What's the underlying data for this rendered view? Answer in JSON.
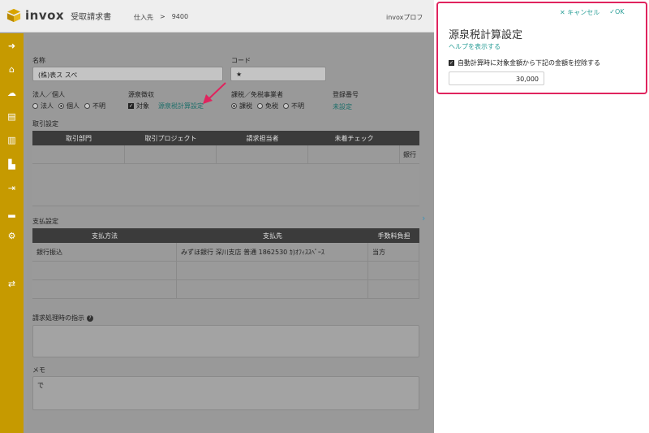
{
  "header": {
    "logo_text": "invox",
    "logo_sub": "受取請求書",
    "breadcrumb_section": "仕入先",
    "breadcrumb_sep": ">",
    "breadcrumb_code": "9400",
    "right_text": "invoxプロフ"
  },
  "sidebar": {
    "icons": [
      "arrow-circle-icon",
      "home-icon",
      "upload-icon",
      "document-icon",
      "document-list-icon",
      "building-icon",
      "export-icon",
      "chart-icon",
      "gear-icon",
      "transfer-icon"
    ]
  },
  "form": {
    "name_label": "名称",
    "name_value": "(株)表ス スペ",
    "code_label": "コード",
    "code_value": "★",
    "entity_label": "法人／個人",
    "entity_options": [
      "法人",
      "個人",
      "不明"
    ],
    "entity_selected": "個人",
    "withholding_label": "源泉徴収",
    "withholding_check_label": "対象",
    "withholding_link": "源泉税計算設定",
    "tax_label": "課税／免税事業者",
    "tax_options": [
      "課税",
      "免税",
      "不明"
    ],
    "tax_selected": "課税",
    "registration_label": "登録番号",
    "registration_value": "未設定"
  },
  "trade_settings": {
    "title": "取引設定",
    "headers": [
      "取引部門",
      "取引プロジェクト",
      "請求担当者",
      "未着チェック"
    ],
    "rows": [
      [
        "",
        "",
        "",
        "",
        "銀行"
      ],
      [
        "",
        "",
        "",
        "",
        ""
      ]
    ]
  },
  "payment_settings": {
    "title": "支払設定",
    "headers": [
      "支払方法",
      "支払先",
      "手数料負担"
    ],
    "rows": [
      [
        "銀行振込",
        "みずほ銀行 深川支店 普通 1862530 ｶ)ｵﾌｨｽｽﾍﾟｰｽ",
        "当方"
      ],
      [
        "",
        "",
        ""
      ],
      [
        "",
        "",
        ""
      ]
    ]
  },
  "instructions": {
    "label": "請求処理時の指示",
    "help_icon": "question-icon",
    "value": ""
  },
  "memo": {
    "label": "メモ",
    "value": "で"
  },
  "panel": {
    "cancel_label": "キャンセル",
    "ok_label": "OK",
    "title": "源泉税計算設定",
    "help_link": "ヘルプを表示する",
    "checkbox_label": "自動計算時に対象金額から下記の金額を控除する",
    "checkbox_checked": true,
    "deduction_value": "30,000"
  },
  "colors": {
    "sidebar": "#c69a00",
    "accent": "#2c9f98",
    "highlight": "#e0245e"
  }
}
